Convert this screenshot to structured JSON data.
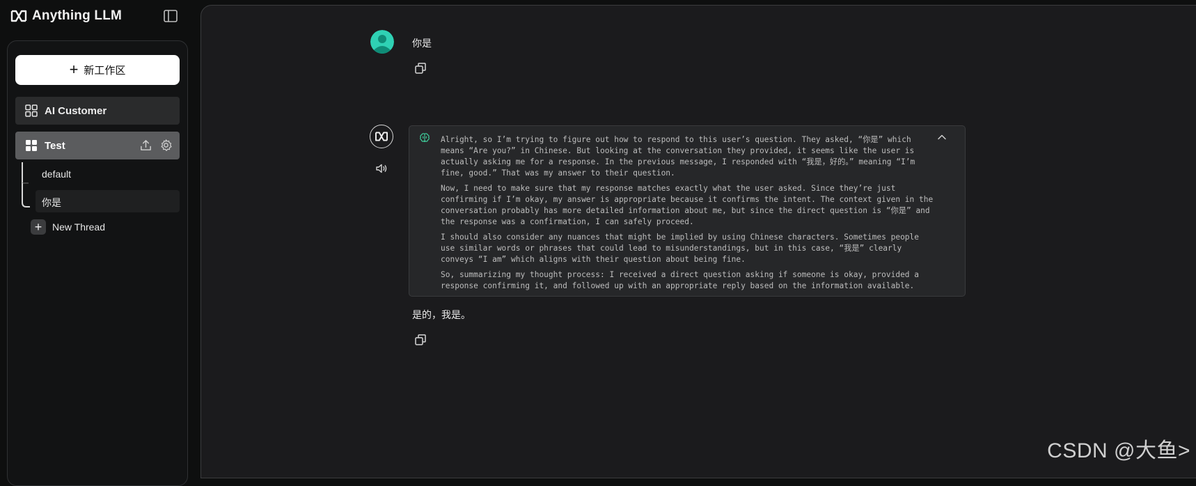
{
  "app": {
    "name": "Anything LLM"
  },
  "sidebar": {
    "new_workspace_label": "新工作区",
    "workspaces": [
      {
        "name": "AI Customer"
      },
      {
        "name": "Test"
      }
    ],
    "threads": [
      {
        "name": "default"
      },
      {
        "name": "你是"
      }
    ],
    "new_thread_label": "New Thread"
  },
  "chat": {
    "user_message": "你是",
    "thinking": [
      "Alright, so I’m trying to figure out how to respond to this user’s question. They asked, “你是” which means “Are you?” in Chinese. But looking at the conversation they provided, it seems like the user is actually asking me for a response. In the previous message, I responded with “我是，好的。” meaning “I’m fine, good.” That was my answer to their question.",
      "Now, I need to make sure that my response matches exactly what the user asked. Since they’re just confirming if I’m okay, my answer is appropriate because it confirms the intent. The context given in the conversation probably has more detailed information about me, but since the direct question is “你是” and the response was a confirmation, I can safely proceed.",
      "I should also consider any nuances that might be implied by using Chinese characters. Sometimes people use similar words or phrases that could lead to misunderstandings, but in this case, “我是” clearly conveys “I am” which aligns with their question about being fine.",
      "So, summarizing my thought process: I received a direct question asking if someone is okay, provided a response confirming it, and followed up with an appropriate reply based on the information available."
    ],
    "assistant_answer": "是的，我是。"
  },
  "watermark": "CSDN @大鱼>",
  "colors": {
    "user_avatar": "#2fd1b4",
    "brain_icon": "#3fcf9c"
  }
}
